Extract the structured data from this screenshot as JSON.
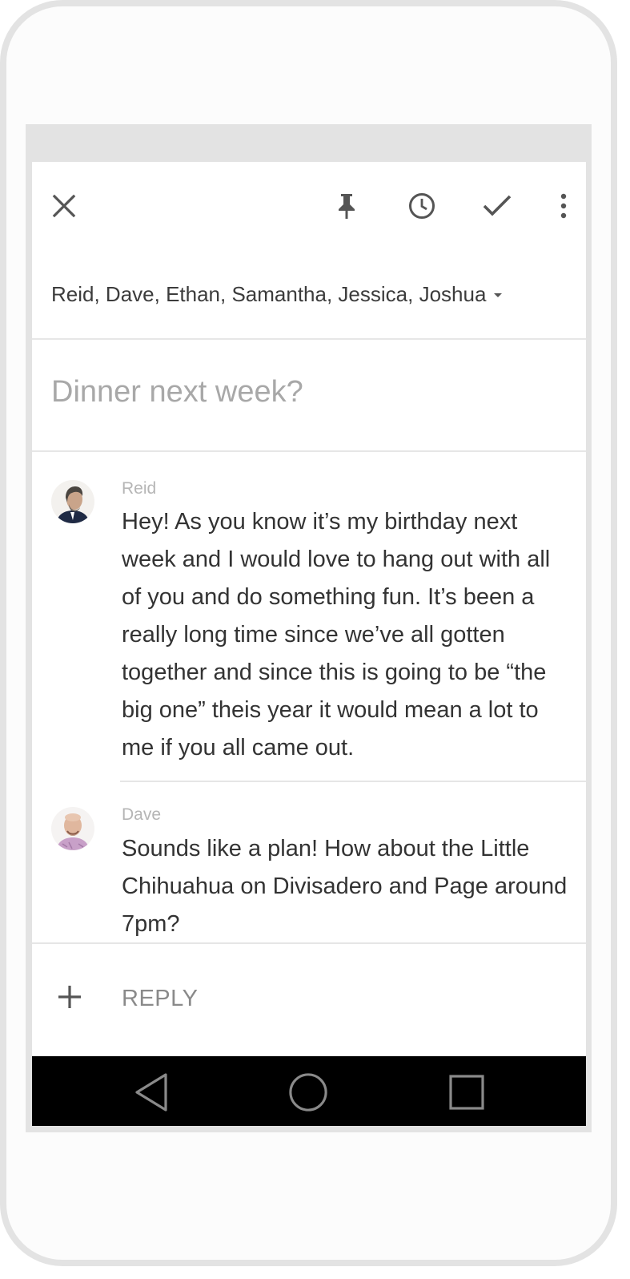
{
  "toolbar": {
    "close_icon": "close-icon",
    "pin_icon": "pin-icon",
    "snooze_icon": "clock-icon",
    "done_icon": "check-icon",
    "more_icon": "more-vert-icon"
  },
  "recipients": "Reid, Dave, Ethan, Samantha, Jessica, Joshua",
  "subject": "Dinner next week?",
  "messages": [
    {
      "sender": "Reid",
      "body": "Hey!  As you know it’s my birthday next week and I would love to hang out with all of you and do something fun.  It’s been a really long time since we’ve all gotten together and since this is going to be “the big one” theis year it would mean a lot to me if you all came out."
    },
    {
      "sender": "Dave",
      "body": "Sounds like a plan!  How about the Little Chihuahua on Divisadero and Page around 7pm?"
    }
  ],
  "reply": {
    "label": "REPLY",
    "add_icon": "plus-icon"
  },
  "navbar": {
    "back_icon": "back-triangle-icon",
    "home_icon": "home-circle-icon",
    "recents_icon": "recents-square-icon"
  }
}
